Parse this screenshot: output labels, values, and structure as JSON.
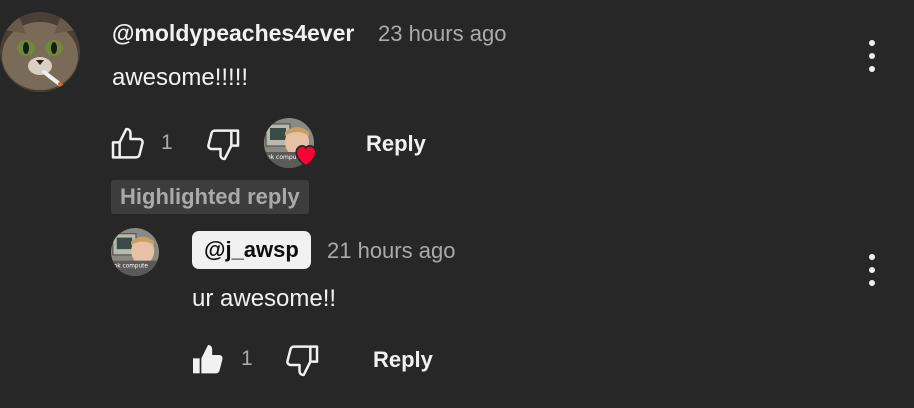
{
  "comment": {
    "author": "@moldypeaches4ever",
    "time": "23 hours ago",
    "text": "awesome!!!!!",
    "like_count": "1",
    "reply_label": "Reply",
    "creator_heart": true
  },
  "highlighted_label": "Highlighted reply",
  "reply": {
    "author": "@j_awsp",
    "time": "21 hours ago",
    "text": "ur awesome!!",
    "like_count": "1",
    "reply_label": "Reply",
    "liked": true
  },
  "avatar_caption": "ok compute",
  "icons": {
    "like": "thumbs-up-outline",
    "like_active": "thumbs-up-filled",
    "dislike": "thumbs-down-outline",
    "menu": "three-dot-vertical",
    "heart": "heart"
  },
  "colors": {
    "background": "#272727",
    "text_primary": "#f1f1f1",
    "text_secondary": "#aaaaaa",
    "heart": "#ff0033",
    "chip_bg": "#f1f1f1"
  }
}
